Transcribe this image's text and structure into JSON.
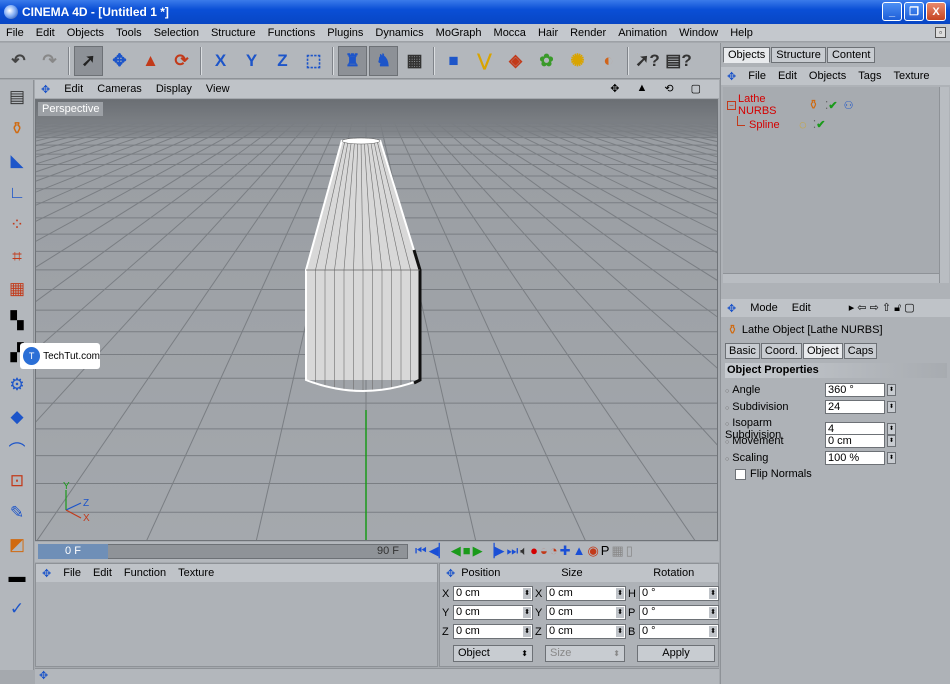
{
  "window": {
    "title": "CINEMA 4D - [Untitled 1 *]",
    "minimize": "_",
    "maximize": "❐",
    "close": "X"
  },
  "menubar": [
    "File",
    "Edit",
    "Objects",
    "Tools",
    "Selection",
    "Structure",
    "Functions",
    "Plugins",
    "Dynamics",
    "MoGraph",
    "Mocca",
    "Hair",
    "Render",
    "Animation",
    "Window",
    "Help"
  ],
  "toolbar_icons": [
    "undo-icon",
    "redo-icon",
    "select-arrow-icon",
    "move-icon",
    "scale-icon",
    "rotate-icon",
    "x-axis-icon",
    "y-axis-icon",
    "z-axis-icon",
    "coord-system-icon",
    "model-mode-icon",
    "object-mode-icon",
    "render-view-icon",
    "cube-icon",
    "spline-icon",
    "nurbs-icon",
    "array-icon",
    "deformer-icon",
    "scene-icon",
    "camera-icon",
    "light-icon"
  ],
  "viewport": {
    "menu": [
      "Edit",
      "Cameras",
      "Display",
      "View"
    ],
    "label": "Perspective",
    "nav_icons": [
      "move-view-icon",
      "scale-view-icon",
      "rotate-view-icon",
      "maximize-view-icon"
    ],
    "axis_labels": {
      "y": "Y",
      "z": "Z",
      "x": "X"
    }
  },
  "timeline": {
    "current_frame": "0 F",
    "end_frame": "90 F"
  },
  "material_panel": {
    "menu": [
      "File",
      "Edit",
      "Function",
      "Texture"
    ]
  },
  "coordinates": {
    "headers": [
      "Position",
      "Size",
      "Rotation"
    ],
    "rows": [
      {
        "pl": "X",
        "pos": "0 cm",
        "sl": "X",
        "size": "0 cm",
        "rl": "H",
        "rot": "0 °"
      },
      {
        "pl": "Y",
        "pos": "0 cm",
        "sl": "Y",
        "size": "0 cm",
        "rl": "P",
        "rot": "0 °"
      },
      {
        "pl": "Z",
        "pos": "0 cm",
        "sl": "Z",
        "size": "0 cm",
        "rl": "B",
        "rot": "0 °"
      }
    ],
    "mode": "Object",
    "size_mode": "Size",
    "apply": "Apply"
  },
  "object_manager": {
    "tabs": [
      "Objects",
      "Structure",
      "Content"
    ],
    "menu": [
      "File",
      "Edit",
      "Objects",
      "Tags",
      "Texture"
    ],
    "objects": [
      {
        "name": "Lathe NURBS",
        "color": "#d40000"
      },
      {
        "name": "Spline",
        "color": "#d40000"
      }
    ]
  },
  "attribute_manager": {
    "menu": [
      "Mode",
      "Edit"
    ],
    "title": "Lathe Object [Lathe NURBS]",
    "tabs": [
      "Basic",
      "Coord.",
      "Object",
      "Caps"
    ],
    "section": "Object Properties",
    "props": [
      {
        "label": "Angle",
        "value": "360 °"
      },
      {
        "label": "Subdivision",
        "value": "24"
      },
      {
        "label": "Isoparm Subdivision",
        "value": "4"
      },
      {
        "label": "Movement",
        "value": "0 cm"
      },
      {
        "label": "Scaling",
        "value": "100 %"
      }
    ],
    "checkbox": "Flip Normals"
  },
  "watermark": "TechTut.com"
}
